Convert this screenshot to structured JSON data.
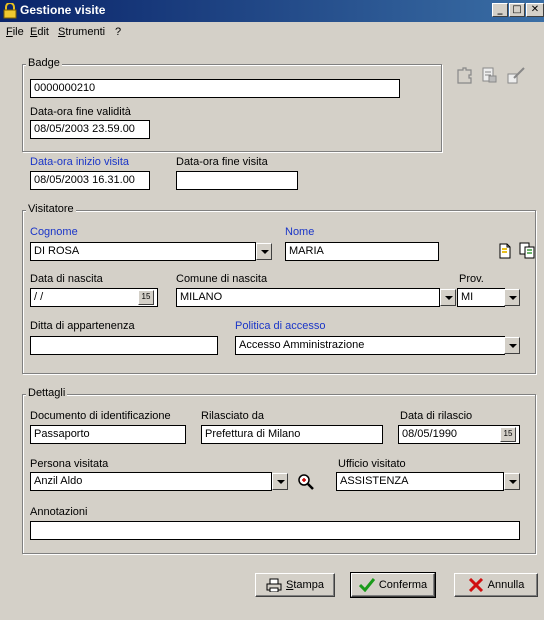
{
  "window": {
    "title": "Gestione visite"
  },
  "menu": [
    {
      "accel": "F",
      "rest": "ile"
    },
    {
      "accel": "E",
      "rest": "dit"
    },
    {
      "accel": "S",
      "rest": "trumenti"
    },
    {
      "accel": "",
      "rest": "?"
    }
  ],
  "badge": {
    "group_label": "Badge",
    "code": "0000000210",
    "validity_label": "Data-ora fine validità",
    "validity_value": "08/05/2003 23.59.00"
  },
  "visit": {
    "start_label": "Data-ora inizio visita",
    "start_value": "08/05/2003 16.31.00",
    "end_label": "Data-ora fine visita",
    "end_value": ""
  },
  "visitor": {
    "group_label": "Visitatore",
    "surname_label": "Cognome",
    "surname_value": "DI ROSA",
    "name_label": "Nome",
    "name_value": "MARIA",
    "birthdate_label": "Data di nascita",
    "birthdate_value": " / /",
    "birthplace_label": "Comune di nascita",
    "birthplace_value": "MILANO",
    "province_label": "Prov.",
    "province_value": "MI",
    "company_label": "Ditta di appartenenza",
    "company_value": "",
    "policy_label": "Politica di accesso",
    "policy_value": "Accesso Amministrazione"
  },
  "details": {
    "group_label": "Dettagli",
    "doc_label": "Documento di identificazione",
    "doc_value": "Passaporto",
    "issued_by_label": "Rilasciato da",
    "issued_by_value": "Prefettura di Milano",
    "issue_date_label": "Data di rilascio",
    "issue_date_value": "08/05/1990",
    "person_label": "Persona visitata",
    "person_value": "Anzil Aldo",
    "office_label": "Ufficio visitato",
    "office_value": "ASSISTENZA",
    "notes_label": "Annotazioni",
    "notes_value": ""
  },
  "buttons": {
    "print_accel": "S",
    "print_rest": "tampa",
    "confirm": "Conferma",
    "cancel": "Annulla"
  },
  "calendar_glyph": "15",
  "colors": {
    "label_blue": "#1a35c8",
    "titlebar": "#0a246a"
  }
}
